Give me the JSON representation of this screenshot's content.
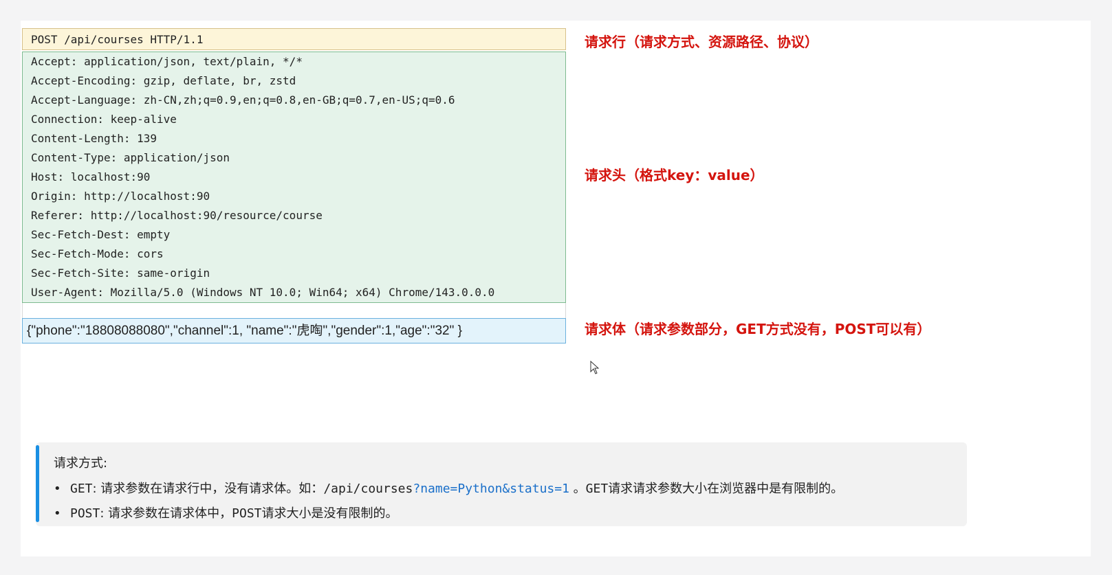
{
  "request_line": "POST /api/courses HTTP/1.1",
  "headers": [
    "Accept: application/json, text/plain, */*",
    "Accept-Encoding: gzip, deflate, br, zstd",
    "Accept-Language: zh-CN,zh;q=0.9,en;q=0.8,en-GB;q=0.7,en-US;q=0.6",
    "Connection: keep-alive",
    "Content-Length: 139",
    "Content-Type: application/json",
    "Host: localhost:90",
    "Origin: http://localhost:90",
    "Referer: http://localhost:90/resource/course",
    "Sec-Fetch-Dest: empty",
    "Sec-Fetch-Mode: cors",
    "Sec-Fetch-Site: same-origin",
    "User-Agent: Mozilla/5.0 (Windows NT 10.0; Win64; x64) Chrome/143.0.0.0"
  ],
  "request_body": "{\"phone\":\"18808088080\",\"channel\":1, \"name\":\"虎啕\",\"gender\":1,\"age\":\"32\" }",
  "annotations": {
    "request_line": "请求行（请求方式、资源路径、协议）",
    "headers": "请求头（格式key：value）",
    "body": "请求体（请求参数部分，GET方式没有，POST可以有）"
  },
  "note": {
    "title": "请求方式:",
    "items": [
      {
        "bullet": "•",
        "method": "GET",
        "text1": ": 请求参数在请求行中，没有请求体。如：",
        "path": "/api/courses",
        "query": "?name=Python&status=1",
        "gap": " 。",
        "method2": "GET",
        "text2": "请求请求参数大小在浏览器中是有限制的。"
      },
      {
        "bullet": "•",
        "method": "POST",
        "text1": ": 请求参数在请求体中，",
        "method2": "POST",
        "text2": "请求大小是没有限制的。"
      }
    ]
  }
}
